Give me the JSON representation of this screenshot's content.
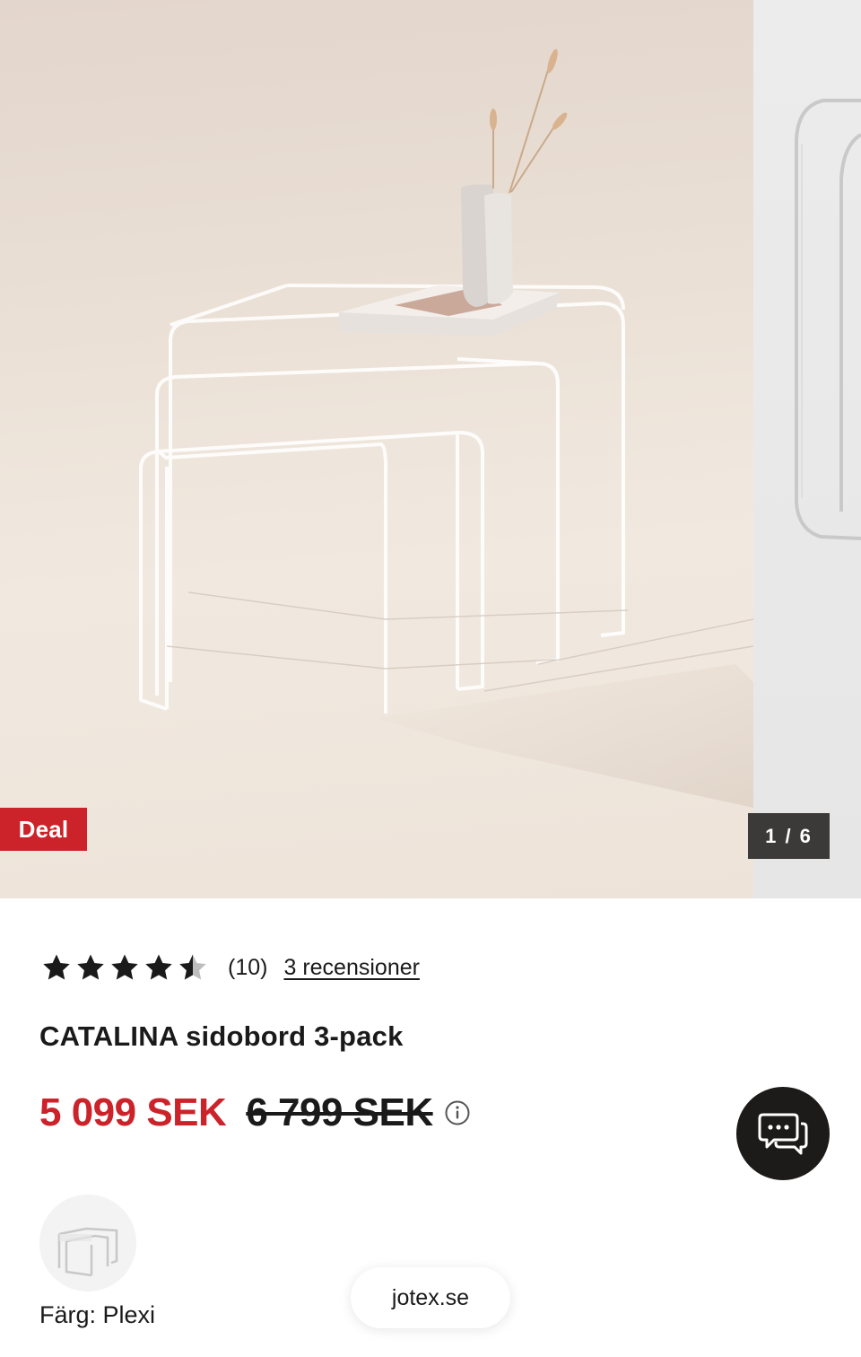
{
  "gallery": {
    "badge": "Deal",
    "counter": "1 / 6",
    "current_slide": 1,
    "total_slides": 6
  },
  "product": {
    "rating": 4.5,
    "rating_max": 5,
    "rating_count": "(10)",
    "reviews_link": "3 recensioner",
    "title": "CATALINA sidobord 3-pack",
    "price_now": "5 099 SEK",
    "price_was": "6 799 SEK",
    "color_label": "Färg: Plexi"
  },
  "browser": {
    "url": "jotex.se"
  },
  "colors": {
    "deal": "#cc2229",
    "text": "#1a1a1a",
    "chat_button": "#1d1b1a"
  },
  "icons": {
    "info": "info-icon",
    "chat": "chat-icon",
    "star": "star-icon"
  }
}
